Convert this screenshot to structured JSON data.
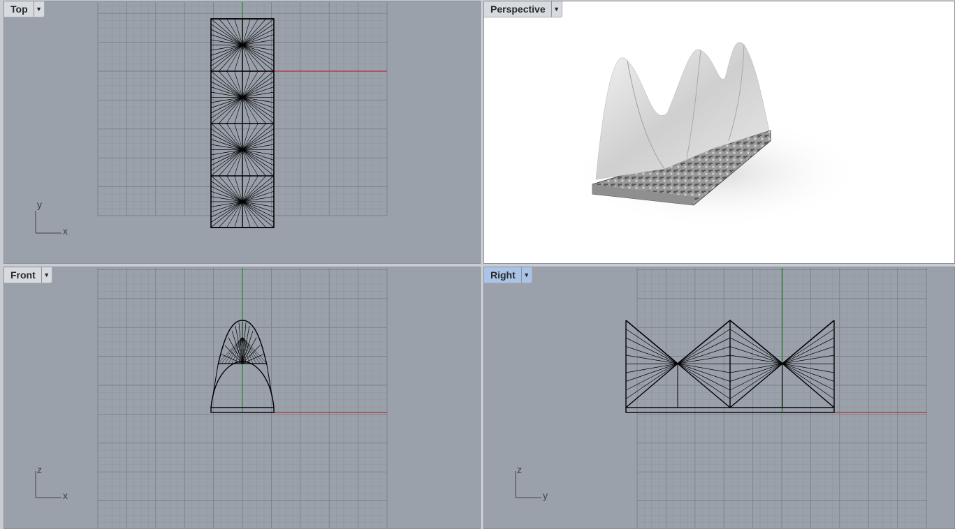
{
  "viewports": {
    "top": {
      "label": "Top",
      "axes": {
        "vertical": "y",
        "horizontal": "x"
      }
    },
    "perspective": {
      "label": "Perspective"
    },
    "front": {
      "label": "Front",
      "axes": {
        "vertical": "z",
        "horizontal": "x"
      }
    },
    "right": {
      "label": "Right",
      "axes": {
        "vertical": "z",
        "horizontal": "y"
      },
      "active": true
    }
  },
  "icons": {
    "menu": "chevron-down-icon"
  },
  "colors": {
    "x_axis": "#b03030",
    "y_axis": "#1f8a1f",
    "grid_minor": "#8b929b",
    "grid_major": "#7a818a",
    "active_tab": "#a9c4e6"
  }
}
